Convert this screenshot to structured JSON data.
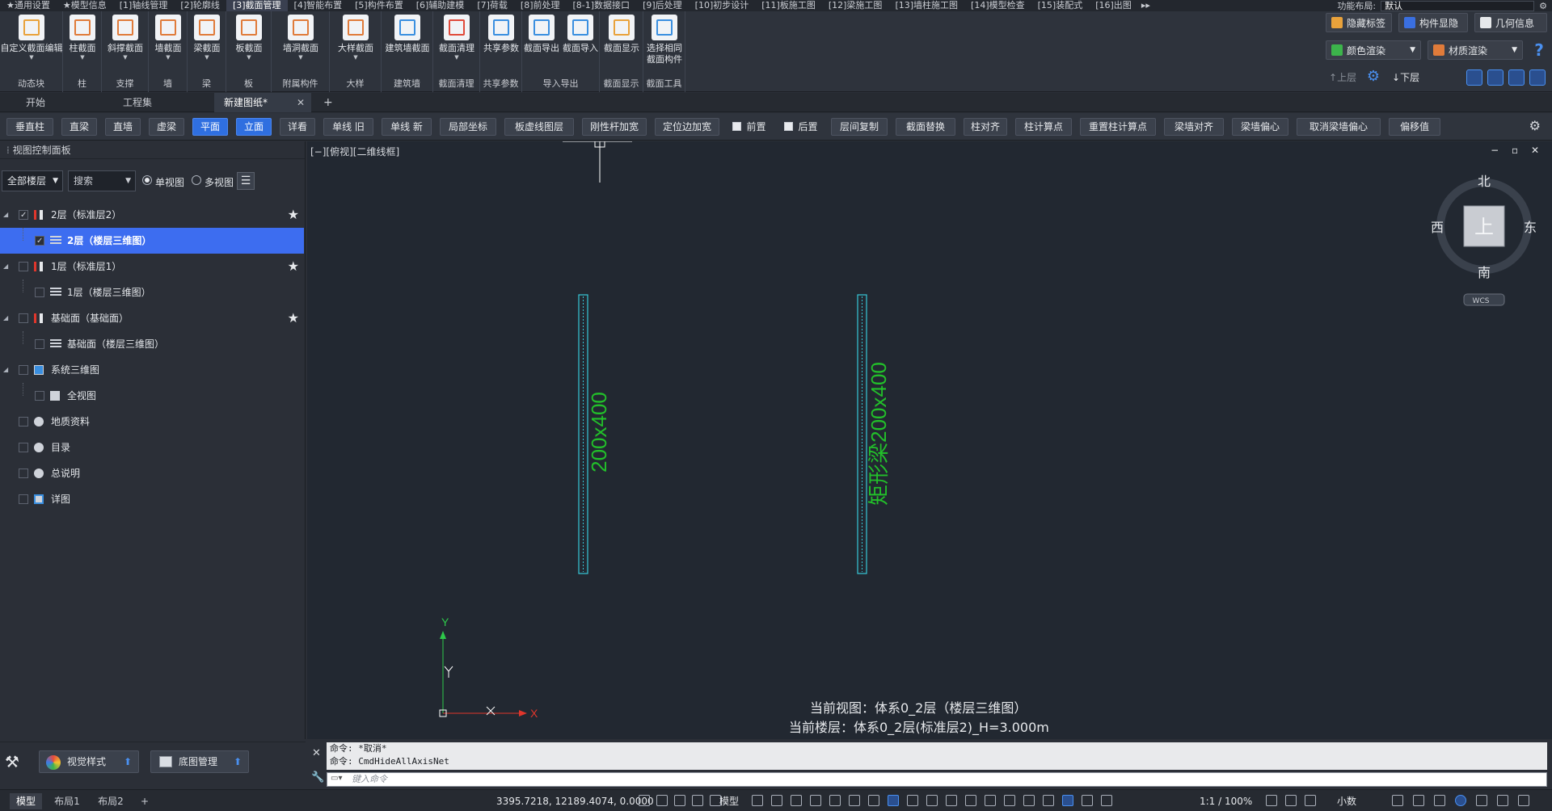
{
  "menu": {
    "items": [
      "★通用设置",
      "★模型信息",
      "[1]轴线管理",
      "[2]轮廓线",
      "[3]截面管理",
      "[4]智能布置",
      "[5]构件布置",
      "[6]辅助建模",
      "[7]荷载",
      "[8]前处理",
      "[8-1]数据接口",
      "[9]后处理",
      "[10]初步设计",
      "[11]板施工图",
      "[12]梁施工图",
      "[13]墙柱施工图",
      "[14]模型检查",
      "[15]装配式",
      "[16]出图"
    ],
    "active_index": 4,
    "layout_label": "功能布局:",
    "layout_value": "默认"
  },
  "ribbon": {
    "groups": [
      {
        "label": "动态块",
        "buttons": [
          "自定义截面编辑"
        ]
      },
      {
        "label": "柱",
        "buttons": [
          "柱截面"
        ]
      },
      {
        "label": "支撑",
        "buttons": [
          "斜撑截面"
        ]
      },
      {
        "label": "墙",
        "buttons": [
          "墙截面"
        ]
      },
      {
        "label": "梁",
        "buttons": [
          "梁截面"
        ]
      },
      {
        "label": "板",
        "buttons": [
          "板截面"
        ]
      },
      {
        "label": "附属构件",
        "buttons": [
          "墙洞截面"
        ]
      },
      {
        "label": "大样",
        "buttons": [
          "大样截面"
        ]
      },
      {
        "label": "建筑墙",
        "buttons": [
          "建筑墙截面"
        ]
      },
      {
        "label": "截面清理",
        "buttons": [
          "截面清理"
        ]
      },
      {
        "label": "共享参数",
        "buttons": [
          "共享参数"
        ]
      },
      {
        "label": "导入导出",
        "buttons": [
          "截面导出",
          "截面导入"
        ]
      },
      {
        "label": "截面显示",
        "buttons": [
          "截面显示"
        ]
      },
      {
        "label": "截面工具",
        "buttons": [
          "选择相同截面构件"
        ]
      }
    ],
    "right": {
      "hide_label": "隐藏标签",
      "component_show": "构件显隐",
      "geometry_info": "几何信息",
      "color_render": "颜色渲染",
      "material_render": "材质渲染",
      "up_floor": "上层",
      "down_floor": "下层",
      "help": "?"
    }
  },
  "doc_tabs": {
    "items": [
      "开始",
      "工程集",
      "新建图纸*"
    ],
    "active_index": 2,
    "close": "✕",
    "add": "+"
  },
  "cmd_bar": {
    "buttons": [
      "垂直柱",
      "直梁",
      "直墙",
      "虚梁",
      "平面",
      "立面",
      "详看",
      "单线 旧",
      "单线 新",
      "局部坐标",
      "板虚线图层",
      "刚性杆加宽",
      "定位边加宽",
      "前置",
      "后置",
      "层间复制",
      "截面替换",
      "柱对齐",
      "柱计算点",
      "重置柱计算点",
      "梁墙对齐",
      "梁墙偏心",
      "取消梁墙偏心",
      "偏移值"
    ],
    "on": [
      "平面",
      "立面"
    ],
    "checkbox_items": [
      "前置",
      "后置"
    ]
  },
  "left_panel": {
    "title": "视图控制面板",
    "floor_filter": "全部楼层",
    "search_placeholder": "搜索",
    "single_view": "单视图",
    "multi_view": "多视图",
    "tree": [
      {
        "label": "2层（标准层2）",
        "level": 0,
        "checked": true,
        "expander": true,
        "star": true,
        "icon": "floor"
      },
      {
        "label": "2层（楼层三维图）",
        "level": 1,
        "checked": true,
        "selected": true,
        "icon": "grid"
      },
      {
        "label": "1层（标准层1）",
        "level": 0,
        "checked": false,
        "expander": true,
        "star": true,
        "icon": "floor"
      },
      {
        "label": "1层（楼层三维图）",
        "level": 1,
        "checked": false,
        "icon": "grid"
      },
      {
        "label": "基础面（基础面）",
        "level": 0,
        "checked": false,
        "expander": true,
        "star": true,
        "icon": "floor"
      },
      {
        "label": "基础面（楼层三维图）",
        "level": 1,
        "checked": false,
        "icon": "grid"
      },
      {
        "label": "系统三维图",
        "level": 0,
        "checked": false,
        "expander": true,
        "icon": "system"
      },
      {
        "label": "全视图",
        "level": 1,
        "checked": false,
        "icon": "square"
      },
      {
        "label": "地质资料",
        "level": 0,
        "checked": false,
        "icon": "circle"
      },
      {
        "label": "目录",
        "level": 0,
        "checked": false,
        "icon": "circle"
      },
      {
        "label": "总说明",
        "level": 0,
        "checked": false,
        "icon": "circle"
      },
      {
        "label": "详图",
        "level": 0,
        "checked": false,
        "icon": "detail"
      }
    ],
    "visual_style": "视觉样式",
    "base_map": "底图管理"
  },
  "canvas": {
    "view_label": "[−][俯视][二维线框]",
    "win_ctrl": "− ▫ ✕",
    "compass": {
      "north": "北",
      "south": "南",
      "east": "东",
      "west": "西",
      "center": "上",
      "wcs": "WCS"
    },
    "beam_left_label": "200x400",
    "beam_right_label": "矩形梁200x400",
    "axis_x": "X",
    "axis_y": "Y",
    "status_line1": "当前视图：体系0_2层（楼层三维图）",
    "status_line2": "当前楼层：体系0_2层(标准层2)_H=3.000m"
  },
  "command": {
    "history": [
      "命令: *取消*",
      "命令: CmdHideAllAxisNet"
    ],
    "placeholder": "键入命令"
  },
  "status_bar": {
    "tabs": [
      "模型",
      "布局1",
      "布局2"
    ],
    "add": "+",
    "coordinates": "3395.7218, 12189.4074, 0.0000",
    "model": "模型",
    "scale": "1:1 / 100%",
    "decimal": "小数"
  },
  "colors": {
    "accent": "#2f6fe0",
    "selected_row": "#3d6df0",
    "beam_text": "#22c02a",
    "beam_line": "#37c8d8",
    "axis_x": "#e0362c",
    "axis_y": "#2ec84a"
  }
}
